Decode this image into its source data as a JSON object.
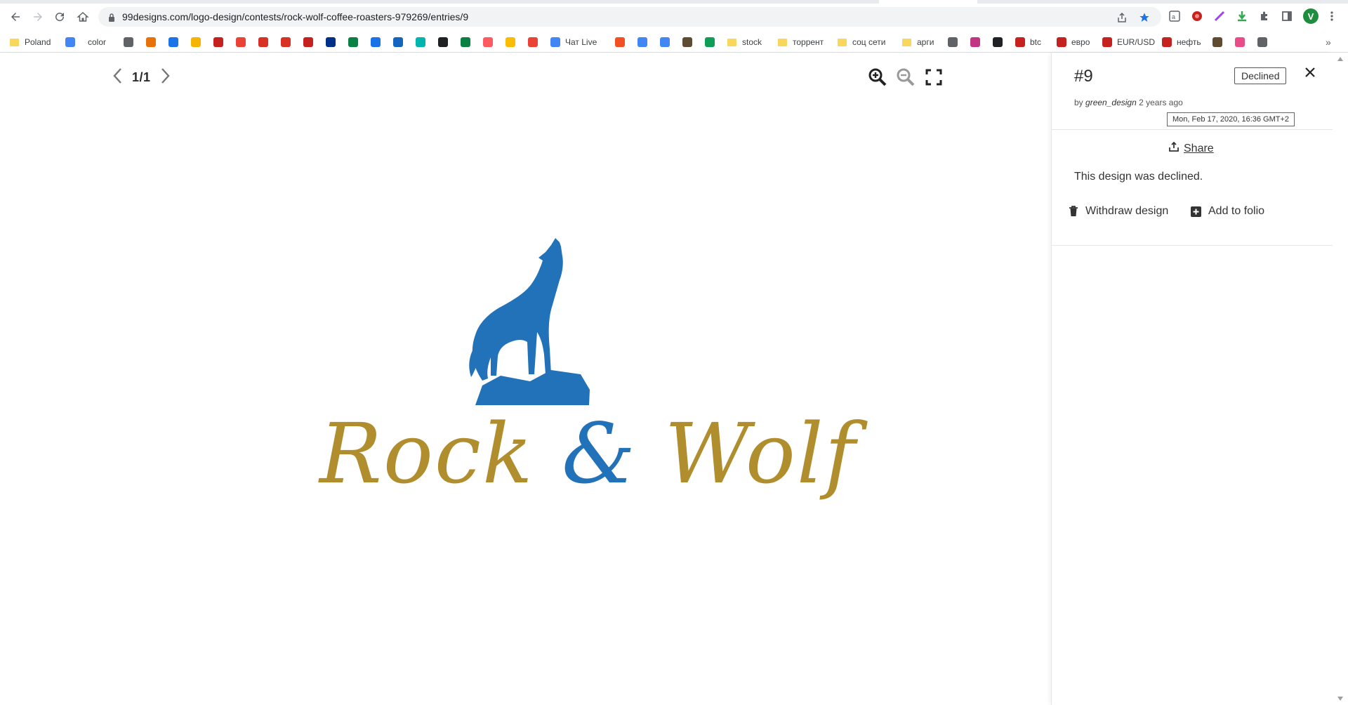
{
  "browser": {
    "url": "99designs.com/logo-design/contests/rock-wolf-coffee-roasters-979269/entries/9",
    "profile_initial": "V",
    "bookmarks": [
      {
        "label": "Poland",
        "kind": "folder"
      },
      {
        "label": "",
        "kind": "icon",
        "color": "#4285f4"
      },
      {
        "label": "color",
        "kind": "text"
      },
      {
        "label": "",
        "kind": "icon",
        "color": "#5f6368"
      },
      {
        "label": "",
        "kind": "icon",
        "color": "#e8710a"
      },
      {
        "label": "",
        "kind": "icon",
        "color": "#1a73e8"
      },
      {
        "label": "",
        "kind": "icon",
        "color": "#f4b400"
      },
      {
        "label": "",
        "kind": "icon",
        "color": "#c5221f"
      },
      {
        "label": "",
        "kind": "icon",
        "color": "#ea4335"
      },
      {
        "label": "",
        "kind": "icon",
        "color": "#d93025"
      },
      {
        "label": "",
        "kind": "icon",
        "color": "#d93025"
      },
      {
        "label": "",
        "kind": "icon",
        "color": "#c5221f"
      },
      {
        "label": "",
        "kind": "icon",
        "color": "#003087"
      },
      {
        "label": "",
        "kind": "icon",
        "color": "#0b8043"
      },
      {
        "label": "",
        "kind": "icon",
        "color": "#1a73e8"
      },
      {
        "label": "",
        "kind": "icon",
        "color": "#1565c0"
      },
      {
        "label": "",
        "kind": "icon",
        "color": "#00b5ad"
      },
      {
        "label": "",
        "kind": "icon",
        "color": "#202124"
      },
      {
        "label": "",
        "kind": "icon",
        "color": "#0b8043"
      },
      {
        "label": "",
        "kind": "icon",
        "color": "#ff5a5f"
      },
      {
        "label": "",
        "kind": "icon",
        "color": "#fbbc04"
      },
      {
        "label": "",
        "kind": "icon",
        "color": "#ea4335"
      },
      {
        "label": "Чат Live",
        "kind": "icon",
        "color": "#4285f4"
      },
      {
        "label": "",
        "kind": "icon",
        "color": "#f25022"
      },
      {
        "label": "",
        "kind": "icon",
        "color": "#4285f4"
      },
      {
        "label": "",
        "kind": "icon",
        "color": "#4285f4"
      },
      {
        "label": "",
        "kind": "icon",
        "color": "#5f4b32"
      },
      {
        "label": "",
        "kind": "icon",
        "color": "#0f9d58"
      },
      {
        "label": "stock",
        "kind": "folder"
      },
      {
        "label": "торрент",
        "kind": "folder"
      },
      {
        "label": "соц сети",
        "kind": "folder"
      },
      {
        "label": "арги",
        "kind": "folder"
      },
      {
        "label": "",
        "kind": "icon",
        "color": "#5f6368"
      },
      {
        "label": "",
        "kind": "icon",
        "color": "#c13584"
      },
      {
        "label": "",
        "kind": "icon",
        "color": "#202124"
      },
      {
        "label": "btc",
        "kind": "icon",
        "color": "#c5221f"
      },
      {
        "label": "евро",
        "kind": "icon",
        "color": "#c5221f"
      },
      {
        "label": "EUR/USD",
        "kind": "icon",
        "color": "#c5221f"
      },
      {
        "label": "нефть",
        "kind": "icon",
        "color": "#c5221f"
      },
      {
        "label": "",
        "kind": "icon",
        "color": "#5f4b32"
      },
      {
        "label": "",
        "kind": "icon",
        "color": "#ea4c89"
      },
      {
        "label": "",
        "kind": "icon",
        "color": "#5f6368"
      }
    ]
  },
  "viewer": {
    "pager": "1/1",
    "logo_word_left": "Rock",
    "logo_amp": "&",
    "logo_word_right": "Wolf",
    "logo_gold": "#b08d2d",
    "logo_blue": "#2272ba"
  },
  "panel": {
    "entry_number": "#9",
    "status": "Declined",
    "by_prefix": "by",
    "designer": "green_design",
    "age": "2 years ago",
    "tooltip": "Mon, Feb 17, 2020, 16:36 GMT+2",
    "share_label": "Share",
    "declined_message": "This design was declined.",
    "withdraw_label": "Withdraw design",
    "folio_label": "Add to folio"
  }
}
